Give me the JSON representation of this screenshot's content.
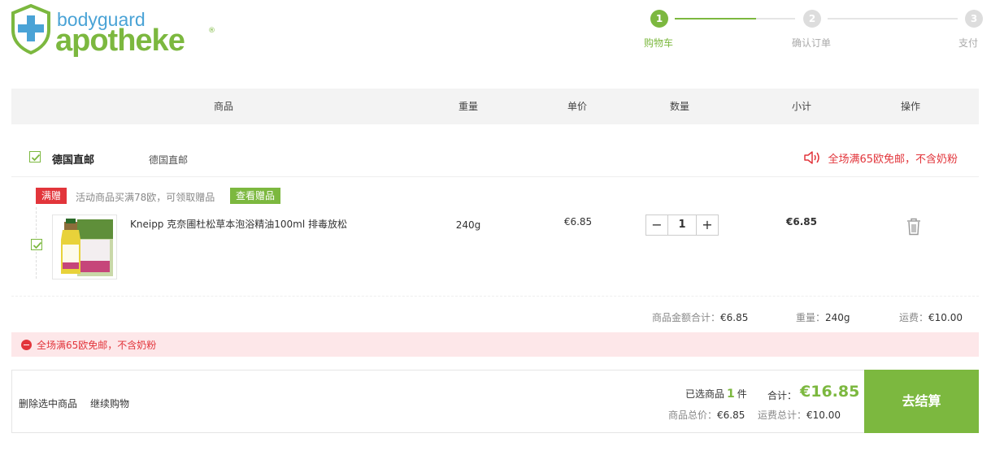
{
  "logo": {
    "top": "bodyguard",
    "main": "apotheke",
    "reg": "®"
  },
  "steps": [
    {
      "num": "1",
      "label": "购物车"
    },
    {
      "num": "2",
      "label": "确认订单"
    },
    {
      "num": "3",
      "label": "支付"
    }
  ],
  "header": [
    "商品",
    "重量",
    "单价",
    "数量",
    "小计",
    "操作"
  ],
  "shop": {
    "name": "德国直邮",
    "sub": "德国直邮",
    "notice": "全场满65欧免邮，不含奶粉"
  },
  "promo": {
    "tag": "满赠",
    "text": "活动商品买满78欧，可领取赠品",
    "button": "查看赠品"
  },
  "item": {
    "name": "Kneipp 克奈圃杜松草本泡浴精油100ml 排毒放松",
    "weight": "240g",
    "price": "€6.85",
    "qty": "1",
    "subtotal": "€6.85"
  },
  "summary": {
    "goods_k": "商品金额合计：",
    "goods_v": "€6.85",
    "weight_k": "重量：",
    "weight_v": "240g",
    "ship_k": "运费：",
    "ship_v": "€10.00"
  },
  "warning": "全场满65欧免邮，不含奶粉",
  "footer": {
    "delete": "删除选中商品",
    "continue": "继续购物",
    "selected_pre": "已选商品",
    "selected_n": "1",
    "selected_post": "件",
    "total_k": "合计：",
    "total_v": "€16.85",
    "goods_total_k": "商品总价：",
    "goods_total_v": "€6.85",
    "ship_total_k": "运费总计：",
    "ship_total_v": "€10.00",
    "checkout": "去结算"
  },
  "colors": {
    "accent": "#7cb83f",
    "alert": "#e2353b",
    "brand_blue": "#4aa3d6"
  }
}
